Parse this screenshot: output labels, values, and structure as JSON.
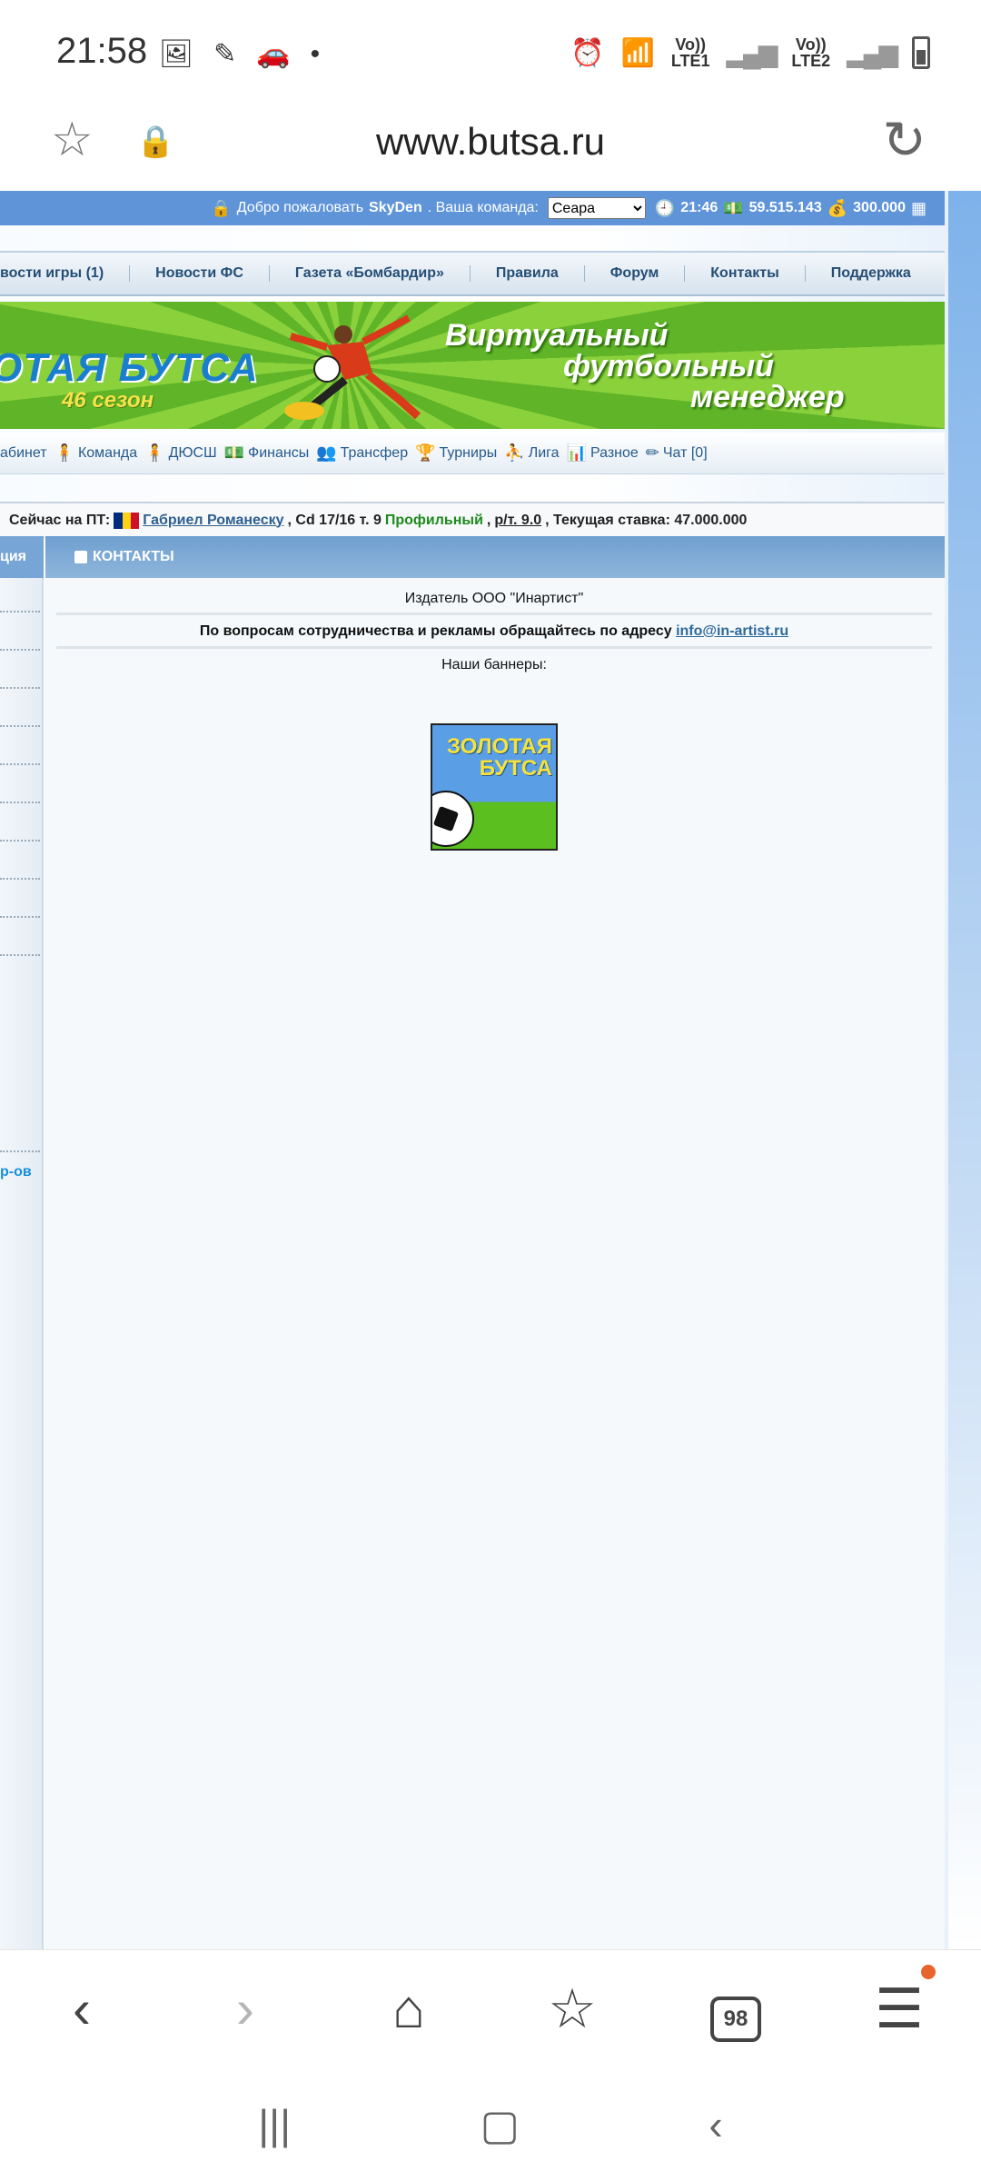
{
  "status_bar": {
    "time": "21:58",
    "left_icons": [
      "image-icon",
      "pen-icon",
      "car-icon",
      "dot-icon"
    ],
    "net1": {
      "label": "Vo))",
      "sub": "LTE1"
    },
    "net2": {
      "label": "Vo))",
      "sub": "LTE2"
    }
  },
  "browser": {
    "url": "www.butsa.ru"
  },
  "topbar": {
    "welcome": "Добро пожаловать",
    "username": "SkyDen",
    "team_label": ". Ваша команда:",
    "team_selected": "Сеара",
    "time": "21:46",
    "money": "59.515.143",
    "bank": "300.000"
  },
  "nav": {
    "items": [
      "вости игры (1)",
      "Новости ФС",
      "Газета «Бомбардир»",
      "Правила",
      "Форум",
      "Контакты",
      "Поддержка"
    ]
  },
  "banner": {
    "title": "ОТАЯ БУТСА",
    "season": "46 сезон",
    "slogan": [
      "Виртуальный",
      "футбольный",
      "менеджер"
    ]
  },
  "submenu": {
    "items": [
      "абинет",
      "Команда",
      "ДЮСШ",
      "Финансы",
      "Трансфер",
      "Турниры",
      "Лига",
      "Разное",
      "Чат [0]"
    ]
  },
  "infoline": {
    "prefix": "Сейчас на ПТ:",
    "player": "Габриел Романеску",
    "pos": ", Cd 17/16 т. 9",
    "type": "Профильный",
    "sep": ",",
    "rating": "р/т. 9.0",
    "bid": ", Текущая ставка: 47.000.000"
  },
  "left": {
    "head": "ция",
    "link": "р-ов"
  },
  "main": {
    "head": "КОНТАКТЫ",
    "publisher": "Издатель ООО \"Инартист\"",
    "coop": "По вопросам сотрудничества и рекламы обращайтесь по адресу",
    "email": "info@in-artist.ru",
    "banners": "Наши баннеры:",
    "banner_text": "ЗОЛОТАЯ БУТСА"
  },
  "toolbar": {
    "tabs_count": "98"
  },
  "colors": {
    "topbar": "#5f95d8",
    "nav_text": "#244e76",
    "link": "#2e6a9c",
    "green": "#1e8a1e"
  }
}
